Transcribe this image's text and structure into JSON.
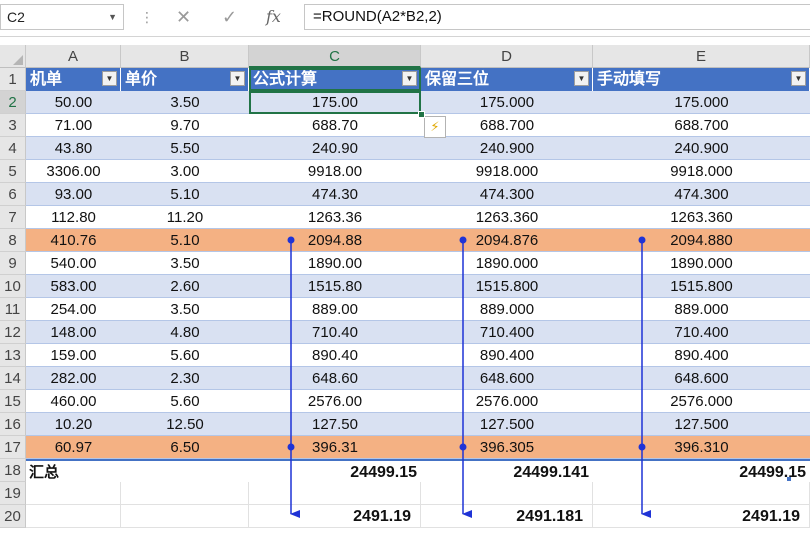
{
  "name_box": "C2",
  "formula": "=ROUND(A2*B2,2)",
  "columns": [
    "A",
    "B",
    "C",
    "D",
    "E"
  ],
  "rows": [
    "1",
    "2",
    "3",
    "4",
    "5",
    "6",
    "7",
    "8",
    "9",
    "10",
    "11",
    "12",
    "13",
    "14",
    "15",
    "16",
    "17",
    "18",
    "19",
    "20"
  ],
  "headers": [
    "机单",
    "单价",
    "公式计算",
    "保留三位",
    "手动填写"
  ],
  "filter_glyph": "▼",
  "data": [
    [
      "50.00",
      "3.50",
      "175.00",
      "175.000",
      "175.000"
    ],
    [
      "71.00",
      "9.70",
      "688.70",
      "688.700",
      "688.700"
    ],
    [
      "43.80",
      "5.50",
      "240.90",
      "240.900",
      "240.900"
    ],
    [
      "3306.00",
      "3.00",
      "9918.00",
      "9918.000",
      "9918.000"
    ],
    [
      "93.00",
      "5.10",
      "474.30",
      "474.300",
      "474.300"
    ],
    [
      "112.80",
      "11.20",
      "1263.36",
      "1263.360",
      "1263.360"
    ],
    [
      "410.76",
      "5.10",
      "2094.88",
      "2094.876",
      "2094.880"
    ],
    [
      "540.00",
      "3.50",
      "1890.00",
      "1890.000",
      "1890.000"
    ],
    [
      "583.00",
      "2.60",
      "1515.80",
      "1515.800",
      "1515.800"
    ],
    [
      "254.00",
      "3.50",
      "889.00",
      "889.000",
      "889.000"
    ],
    [
      "148.00",
      "4.80",
      "710.40",
      "710.400",
      "710.400"
    ],
    [
      "159.00",
      "5.60",
      "890.40",
      "890.400",
      "890.400"
    ],
    [
      "282.00",
      "2.30",
      "648.60",
      "648.600",
      "648.600"
    ],
    [
      "460.00",
      "5.60",
      "2576.00",
      "2576.000",
      "2576.000"
    ],
    [
      "10.20",
      "12.50",
      "127.50",
      "127.500",
      "127.500"
    ],
    [
      "60.97",
      "6.50",
      "396.31",
      "396.305",
      "396.310"
    ]
  ],
  "total_label": "汇总",
  "totals": [
    "24499.15",
    "24499.141",
    "24499.15"
  ],
  "sub_totals": [
    "2491.19",
    "2491.181",
    "2491.19"
  ],
  "colors": {
    "header_bg": "#4472c4",
    "band": "#d9e1f2",
    "highlight": "#f4b183",
    "arrow": "#1f33d6",
    "select": "#217346"
  }
}
